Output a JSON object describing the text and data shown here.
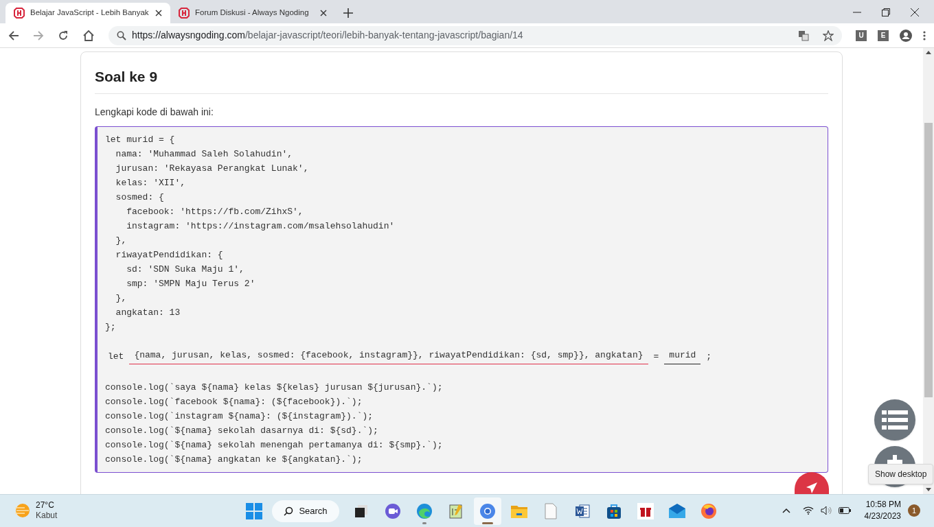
{
  "browser": {
    "tabs": [
      {
        "title": "Belajar JavaScript - Lebih Banyak",
        "selected": true
      },
      {
        "title": "Forum Diskusi - Always Ngoding",
        "selected": false
      }
    ],
    "url_host": "https://alwaysngoding.com",
    "url_path": "/belajar-javascript/teori/lebih-banyak-tentang-javascript/bagian/14",
    "extensions": [
      "U",
      "E"
    ]
  },
  "question": {
    "title": "Soal ke 9",
    "instruction": "Lengkapi kode di bawah ini:",
    "code_before": [
      "let murid = {",
      "  nama: 'Muhammad Saleh Solahudin',",
      "  jurusan: 'Rekayasa Perangkat Lunak',",
      "  kelas: 'XII',",
      "  sosmed: {",
      "    facebook: 'https://fb.com/ZihxS',",
      "    instagram: 'https://instagram.com/msalehsolahudin'",
      "  },",
      "  riwayatPendidikan: {",
      "    sd: 'SDN Suka Maju 1',",
      "    smp: 'SMPN Maju Terus 2'",
      "  },",
      "  angkatan: 13",
      "};"
    ],
    "answer_line": [
      {
        "kind": "code",
        "text": "let"
      },
      {
        "kind": "blank",
        "text": "{nama, jurusan, kelas, sosmed: {facebook, instagram}}, riwayatPendidikan: {sd, smp}}, angkatan}",
        "color": "#e0304a"
      },
      {
        "kind": "code",
        "text": "="
      },
      {
        "kind": "blank",
        "text": "murid",
        "color": "#222222"
      },
      {
        "kind": "code",
        "text": ";"
      }
    ],
    "code_after": [
      "console.log(`saya ${nama} kelas ${kelas} jurusan ${jurusan}.`);",
      "console.log(`facebook ${nama}: (${facebook}).`);",
      "console.log(`instagram ${nama}: (${instagram}).`);",
      "console.log(`${nama} sekolah dasarnya di: ${sd}.`);",
      "console.log(`${nama} sekolah menengah pertamanya di: ${smp}.`);",
      "console.log(`${nama} angkatan ke ${angkatan}.`);"
    ]
  },
  "tooltip": "Show desktop",
  "taskbar": {
    "weather": {
      "temp": "27°C",
      "condition": "Kabut"
    },
    "search": "Search",
    "apps": [
      {
        "kind": "taskview",
        "selected": false,
        "running": false
      },
      {
        "kind": "meet",
        "selected": false,
        "running": false
      },
      {
        "kind": "edge",
        "selected": false,
        "running": true
      },
      {
        "kind": "notepad",
        "selected": false,
        "running": false
      },
      {
        "kind": "chrome",
        "selected": true,
        "running": true
      },
      {
        "kind": "folder",
        "selected": false,
        "running": false
      },
      {
        "kind": "file",
        "selected": false,
        "running": false
      },
      {
        "kind": "word",
        "selected": false,
        "running": false
      },
      {
        "kind": "store",
        "selected": false,
        "running": false
      },
      {
        "kind": "gift",
        "selected": false,
        "running": false
      },
      {
        "kind": "mail",
        "selected": false,
        "running": false
      },
      {
        "kind": "firefox",
        "selected": false,
        "running": false
      }
    ],
    "time": "10:58 PM",
    "date": "4/23/2023",
    "notifications": "1"
  }
}
